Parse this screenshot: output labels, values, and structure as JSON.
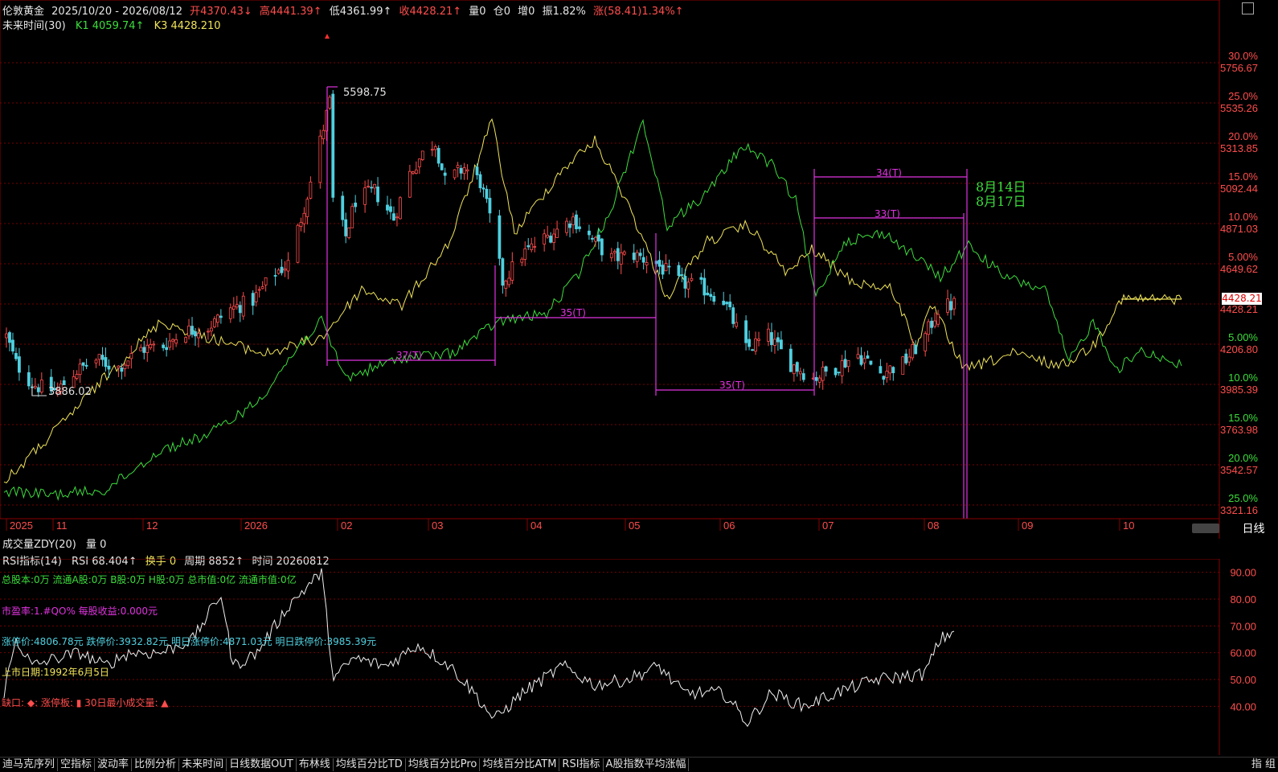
{
  "header": {
    "name": "伦敦黄金",
    "range": "2025/10/20 - 2026/08/12",
    "open": "开4370.43↓",
    "high": "高4441.39↑",
    "low": "低4361.99↑",
    "close": "收4428.21↑",
    "volume": "量0",
    "position": "仓0",
    "increase": "增0",
    "amplitude": "振1.82%",
    "change": "涨(58.41)1.34%↑"
  },
  "indicator_line": {
    "name": "未来时间(30)",
    "k1": "K1 4059.74↑",
    "k3": "K3 4428.210"
  },
  "price_axis": {
    "labels": [
      {
        "pct": "30.0%",
        "price": "5756.67",
        "v": 5756.67
      },
      {
        "pct": "25.0%",
        "price": "5535.26",
        "v": 5535.26
      },
      {
        "pct": "20.0%",
        "price": "5313.85",
        "v": 5313.85
      },
      {
        "pct": "15.0%",
        "price": "5092.44",
        "v": 5092.44
      },
      {
        "pct": "10.0%",
        "price": "4871.03",
        "v": 4871.03
      },
      {
        "pct": "5.00%",
        "price": "4649.62",
        "v": 4649.62
      },
      {
        "pct": "0.00%",
        "price": "4428.21",
        "v": 4428.21
      },
      {
        "pct": "5.00%",
        "price": "4206.80",
        "v": 4206.8
      },
      {
        "pct": "10.0%",
        "price": "3985.39",
        "v": 3985.39
      },
      {
        "pct": "15.0%",
        "price": "3763.98",
        "v": 3763.98
      },
      {
        "pct": "20.0%",
        "price": "3542.57",
        "v": 3542.57
      },
      {
        "pct": "25.0%",
        "price": "3321.16",
        "v": 3321.16
      }
    ],
    "current_price": "4428.21"
  },
  "annotations": {
    "high_label": "5598.75",
    "low_label": "3886.02",
    "cycles": [
      "37(T)",
      "35(T)",
      "35(T)",
      "34(T)",
      "33(T)"
    ],
    "date1": "8月14日",
    "date2": "8月17日"
  },
  "time_axis": [
    "2025",
    "11",
    "12",
    "2026",
    "02",
    "03",
    "04",
    "05",
    "06",
    "07",
    "08",
    "09",
    "10"
  ],
  "period_button": "日线",
  "volume_line": {
    "name": "成交量ZDY(20)",
    "value": "量 0"
  },
  "rsi_line": {
    "name": "RSI指标(14)",
    "rsi": "RSI 68.404↑",
    "turnover": "换手 0",
    "period": "周期 8852↑",
    "time": "时间 20260812"
  },
  "rsi_axis": [
    "90.00",
    "80.00",
    "70.00",
    "60.00",
    "50.00",
    "40.00"
  ],
  "info": {
    "capital": "总股本:0万  流通A股:0万  B股:0万  H股:0万  总市值:0亿  流通市值:0亿",
    "pe": "市盈率:1.#QO%  每股收益:0.000元",
    "limits": "涨停价:4806.78元  跌停价:3932.82元  明日涨停价:4871.03元  明日跌停价:3985.39元",
    "listing": "上市日期:1992年6月5日",
    "legend": "缺口: ◆: 涨停板: ▮ 30日最小成交量: ▲"
  },
  "tabs": [
    "迪马克序列",
    "空指标",
    "波动率",
    "比例分析",
    "未来时间",
    "日线数据OUT",
    "布林线",
    "均线百分比TD",
    "均线百分比Pro",
    "均线百分比ATM",
    "RSI指标",
    "A股指数平均涨幅"
  ],
  "right_tab": "指 组",
  "colors": {
    "up": "#ff4d4d",
    "down": "#4fd0e0",
    "cycle": "#e033e0",
    "yellow_line": "#f0e45a",
    "green_line": "#3cde3c",
    "grid": "#7a0000"
  },
  "chart_data": {
    "type": "candlestick",
    "x_start": "2025/10/20",
    "x_end": "2026/08/12",
    "ylim": [
      3321.16,
      5756.67
    ],
    "close_path": [
      [
        "2025-10-20",
        4250
      ],
      [
        "2025-10-23",
        4100
      ],
      [
        "2025-10-28",
        3990
      ],
      [
        "2025-11-01",
        3960
      ],
      [
        "2025-11-05",
        3950
      ],
      [
        "2025-11-10",
        4050
      ],
      [
        "2025-11-17",
        4120
      ],
      [
        "2025-11-24",
        4080
      ],
      [
        "2025-12-01",
        4180
      ],
      [
        "2025-12-08",
        4200
      ],
      [
        "2025-12-15",
        4280
      ],
      [
        "2025-12-22",
        4300
      ],
      [
        "2025-12-29",
        4400
      ],
      [
        "2026-01-05",
        4450
      ],
      [
        "2026-01-12",
        4600
      ],
      [
        "2026-01-16",
        4650
      ],
      [
        "2026-01-20",
        4900
      ],
      [
        "2026-01-23",
        5100
      ],
      [
        "2026-01-27",
        5400
      ],
      [
        "2026-01-29",
        5540
      ],
      [
        "2026-01-30",
        5000
      ],
      [
        "2026-02-03",
        4800
      ],
      [
        "2026-02-06",
        5000
      ],
      [
        "2026-02-12",
        5050
      ],
      [
        "2026-02-18",
        4900
      ],
      [
        "2026-02-23",
        5150
      ],
      [
        "2026-02-28",
        5280
      ],
      [
        "2026-03-03",
        5320
      ],
      [
        "2026-03-06",
        5100
      ],
      [
        "2026-03-12",
        5180
      ],
      [
        "2026-03-17",
        5100
      ],
      [
        "2026-03-20",
        4900
      ],
      [
        "2026-03-24",
        4550
      ],
      [
        "2026-03-30",
        4700
      ],
      [
        "2026-04-07",
        4800
      ],
      [
        "2026-04-15",
        4900
      ],
      [
        "2026-04-21",
        4780
      ],
      [
        "2026-04-27",
        4680
      ],
      [
        "2026-05-04",
        4700
      ],
      [
        "2026-05-11",
        4650
      ],
      [
        "2026-05-18",
        4550
      ],
      [
        "2026-05-25",
        4520
      ],
      [
        "2026-06-01",
        4450
      ],
      [
        "2026-06-08",
        4180
      ],
      [
        "2026-06-15",
        4250
      ],
      [
        "2026-06-22",
        4100
      ],
      [
        "2026-06-29",
        4020
      ],
      [
        "2026-07-06",
        4080
      ],
      [
        "2026-07-13",
        4150
      ],
      [
        "2026-07-20",
        4050
      ],
      [
        "2026-07-27",
        4100
      ],
      [
        "2026-08-03",
        4250
      ],
      [
        "2026-08-07",
        4400
      ],
      [
        "2026-08-12",
        4428.21
      ]
    ]
  }
}
